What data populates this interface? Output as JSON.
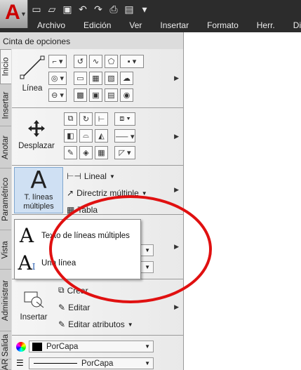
{
  "menubar": {
    "items": [
      "Archivo",
      "Edición",
      "Ver",
      "Insertar",
      "Formato",
      "Herr.",
      "Dibujo"
    ]
  },
  "ribbon": {
    "title": "Cinta de opciones",
    "tabs": [
      "Inicio",
      "Insertar",
      "Anotar",
      "Paramétrico",
      "Vista",
      "Administrar",
      "Salida",
      "AR"
    ]
  },
  "panels": {
    "draw": {
      "label": "Línea"
    },
    "modify": {
      "label": "Desplazar"
    },
    "annotate": {
      "big_label": "T. líneas múltiples",
      "line1": "Lineal",
      "line2": "Directriz múltiple",
      "line3": "Tabla"
    },
    "block": {
      "big_label": "Insertar",
      "b1": "Crear",
      "b2": "Editar",
      "b3": "Editar atributos"
    },
    "properties": {
      "color": "PorCapa",
      "linetype": "PorCapa"
    }
  },
  "popup": {
    "item1": "Texto de líneas múltiples",
    "item2": "Una línea"
  },
  "colors": {
    "annotation_circle": "#e01010",
    "title_bar": "#2c2c2c"
  }
}
